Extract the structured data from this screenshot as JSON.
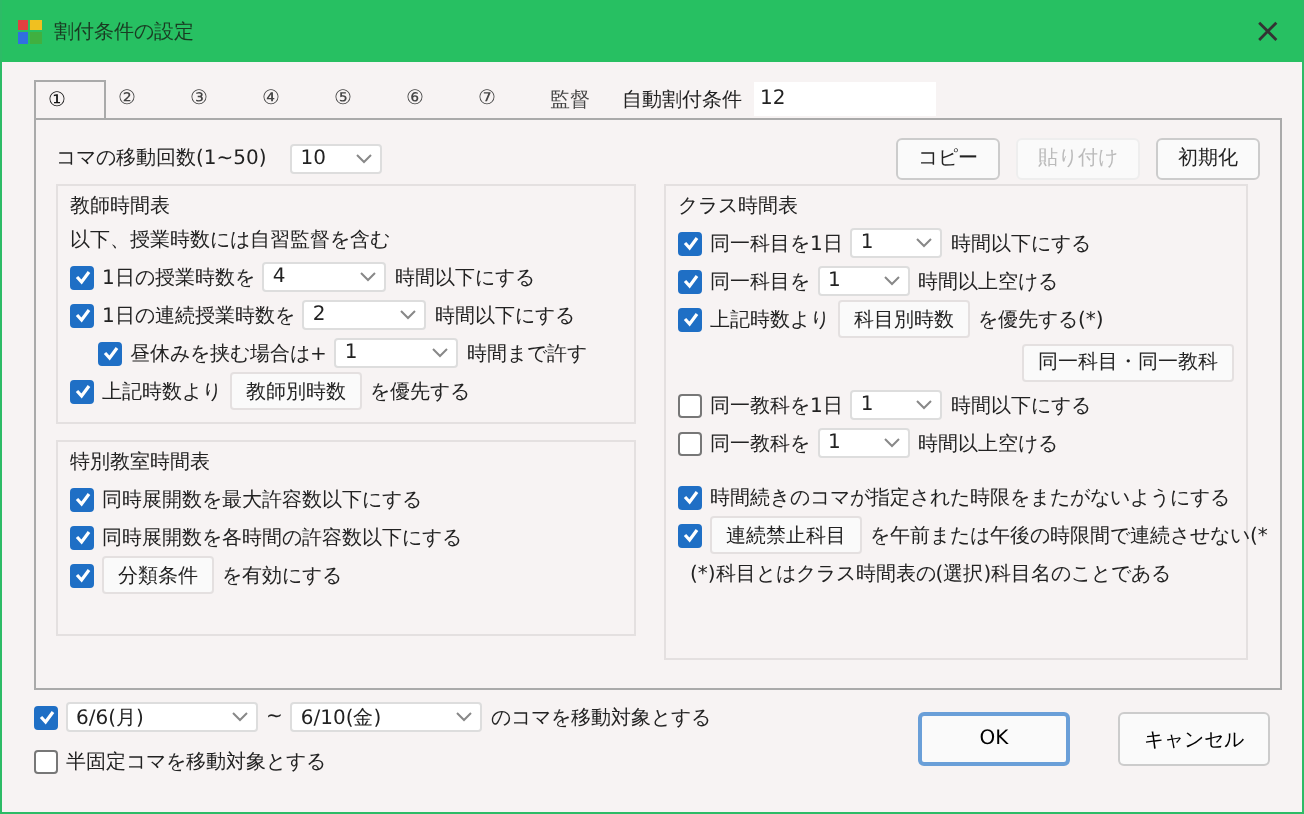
{
  "window": {
    "title": "割付条件の設定",
    "close": "×"
  },
  "tabs": [
    {
      "label": "①",
      "selected": true
    },
    {
      "label": "②",
      "selected": false
    },
    {
      "label": "③",
      "selected": false
    },
    {
      "label": "④",
      "selected": false
    },
    {
      "label": "⑤",
      "selected": false
    },
    {
      "label": "⑥",
      "selected": false
    },
    {
      "label": "⑦",
      "selected": false
    },
    {
      "label": "監督",
      "selected": false
    }
  ],
  "auto_condition": {
    "label": "自動割付条件",
    "value": "12"
  },
  "move_count": {
    "label": "コマの移動回数(1~50)",
    "value": "10"
  },
  "edit_buttons": [
    {
      "label": "コピー",
      "disabled": false
    },
    {
      "label": "貼り付け",
      "disabled": true
    },
    {
      "label": "初期化",
      "disabled": false
    }
  ],
  "teacher_group": {
    "title": "教師時間表",
    "note": "以下、授業時数には自習監督を含む",
    "rows": [
      {
        "kind": "check",
        "checked": true,
        "parts": [
          {
            "kind": "text",
            "text": "1日の授業時数を"
          },
          {
            "kind": "select",
            "value": "4"
          },
          {
            "kind": "text",
            "text": "時間以下にする"
          }
        ]
      },
      {
        "kind": "check",
        "checked": true,
        "parts": [
          {
            "kind": "text",
            "text": "1日の連続授業時数を"
          },
          {
            "kind": "select",
            "value": "2"
          },
          {
            "kind": "text",
            "text": "時間以下にする"
          }
        ],
        "children": [
          {
            "kind": "check",
            "checked": true,
            "parts": [
              {
                "kind": "text",
                "text": "昼休みを挟む場合は+"
              },
              {
                "kind": "select",
                "value": "1"
              },
              {
                "kind": "text",
                "text": "時間まで許す"
              }
            ]
          }
        ]
      },
      {
        "kind": "check",
        "checked": true,
        "parts": [
          {
            "kind": "text",
            "text": "上記時数より"
          },
          {
            "kind": "button",
            "label": "教師別時数"
          },
          {
            "kind": "text",
            "text": "を優先する"
          }
        ]
      }
    ]
  },
  "special_group": {
    "title": "特別教室時間表",
    "rows": [
      {
        "kind": "check",
        "checked": true,
        "parts": [
          {
            "kind": "text",
            "text": "同時展開数を最大許容数以下にする"
          }
        ]
      },
      {
        "kind": "check",
        "checked": true,
        "parts": [
          {
            "kind": "text",
            "text": "同時展開数を各時間の許容数以下にする"
          }
        ]
      },
      {
        "kind": "check",
        "checked": true,
        "parts": [
          {
            "kind": "button",
            "label": "分類条件"
          },
          {
            "kind": "text",
            "text": "を有効にする"
          }
        ]
      }
    ]
  },
  "class_group": {
    "title": "クラス時間表",
    "rows": [
      {
        "kind": "check",
        "checked": true,
        "parts": [
          {
            "kind": "text",
            "text": "同一科目を1日"
          },
          {
            "kind": "select",
            "value": "1"
          },
          {
            "kind": "text",
            "text": "時間以下にする"
          }
        ]
      },
      {
        "kind": "check",
        "checked": true,
        "parts": [
          {
            "kind": "text",
            "text": "同一科目を"
          },
          {
            "kind": "select",
            "value": "1"
          },
          {
            "kind": "text",
            "text": "時間以上空ける"
          }
        ]
      },
      {
        "kind": "check",
        "checked": true,
        "parts": [
          {
            "kind": "text",
            "text": "上記時数より"
          },
          {
            "kind": "button",
            "label": "科目別時数"
          },
          {
            "kind": "text",
            "text": "を優先する(*)"
          }
        ]
      },
      {
        "kind": "button",
        "label": "同一科目・同一教科"
      },
      {
        "kind": "check",
        "checked": false,
        "parts": [
          {
            "kind": "text",
            "text": "同一教科を1日"
          },
          {
            "kind": "select",
            "value": "1"
          },
          {
            "kind": "text",
            "text": "時間以下にする"
          }
        ]
      },
      {
        "kind": "check",
        "checked": false,
        "parts": [
          {
            "kind": "text",
            "text": "同一教科を"
          },
          {
            "kind": "select",
            "value": "1"
          },
          {
            "kind": "text",
            "text": "時間以上空ける"
          }
        ]
      },
      {
        "kind": "spacer"
      },
      {
        "kind": "check",
        "checked": true,
        "parts": [
          {
            "kind": "text",
            "text": "時間続きのコマが指定された時限をまたがないようにする"
          }
        ]
      },
      {
        "kind": "check",
        "checked": true,
        "parts": [
          {
            "kind": "button",
            "label": "連続禁止科目"
          },
          {
            "kind": "text",
            "text": "を午前または午後の時限間で連続させない(*"
          }
        ]
      },
      {
        "kind": "note",
        "text": "(*)科目とはクラス時間表の(選択)科目名のことである"
      }
    ]
  },
  "date_range": {
    "checked": true,
    "from": "6/6(月)",
    "separator": "~",
    "to": "6/10(金)",
    "text": "のコマを移動対象とする"
  },
  "semi_fixed": {
    "checked": false,
    "text": "半固定コマを移動対象とする"
  },
  "dialog_buttons": [
    {
      "label": "OK",
      "default": true
    },
    {
      "label": "キャンセル",
      "default": false
    }
  ]
}
